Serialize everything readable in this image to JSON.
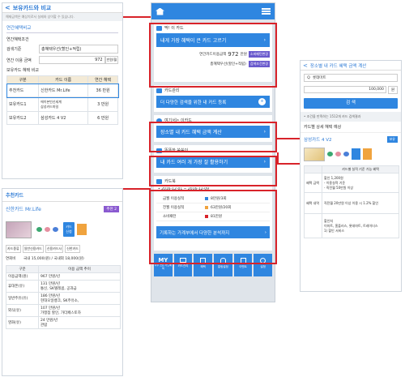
{
  "left_panel": {
    "back": "<",
    "title": "보유카드와 비교",
    "note": "해제금액은 예상치로서 실제와 상이할 수 있습니다.",
    "section1": "연간혜택비교",
    "cond_title": "연간혜택조건",
    "cond_rows": [
      {
        "label": "검색기준",
        "value": "총혜택우선(할인+적립)"
      },
      {
        "label": "연간 이용 금액",
        "value": "972",
        "unit": "만원/월"
      }
    ],
    "section2": "보유카드 혜택 비교",
    "table_headers": [
      "구분",
      "카드 이름",
      "연간 혜택"
    ],
    "table_rows": [
      {
        "type": "추천카드",
        "name": "신한카드 Mr.Life",
        "benefit": "36 만원"
      },
      {
        "type": "보유카드1",
        "name": "에이본빈신세계\n삼성카드마일",
        "benefit": "3 만원"
      },
      {
        "type": "보유카드2",
        "name": "삼성카드 4 V2",
        "benefit": "6 만원"
      }
    ]
  },
  "rec_panel": {
    "title": "추천카드",
    "card_name": "신한카드 Mr.Life",
    "badge": "추천 2",
    "icons": [
      "보유카드 비교",
      "관심카드 담기",
      "카드사 홈페이지"
    ],
    "apply": "카드신청",
    "tags": [
      "카드종류",
      "일반신용카드",
      "신용카드사",
      "신한카드"
    ],
    "fee_label": "연회비",
    "fee_value": "국내 15,000(원) / 국내외 18,000(원)",
    "th": [
      "구분",
      "이용 금액 추이"
    ],
    "rows": [
      {
        "a": "이용금액(원)",
        "b": "967 만원/년"
      },
      {
        "a": "휴대폰(유)",
        "b": "131 만원/년\n통신, SK텔레콤, 공과금"
      },
      {
        "a": "일반주유(유)",
        "b": "186 만원/년\n현대오일뱅크, SK주유소,"
      },
      {
        "a": "외식(유)",
        "b": "107 만원/년\n가맹점 할인, 가더페스토하"
      },
      {
        "a": "영화(유)",
        "b": "24 만원/년\n관람"
      }
    ]
  },
  "phone": {
    "status": "",
    "s1_label": "딱! 이 카드",
    "s1_btn": "내게 가장 혜택이 큰 카드 고르기",
    "s1_l1": "연간카드이용금액",
    "s1_v1": "972",
    "s1_u1": "만원",
    "s1_b1": "소비패턴변경",
    "s1_l2": "총혜택우선(할인+적립)",
    "s1_b2": "검색조건변경",
    "s2_label": "카드관리",
    "s2_btn": "더 다양한 검색을 위한 내 카드 등록",
    "s3_label": "여기서는 이카드",
    "s3_btn": "장소별 내 카드 혜택 금액 계산",
    "s4_label": "똑똑한 씀씀이",
    "s4_btn": "내 카드 여러 개 가장 잘 활용하기",
    "s5_label": "카드북",
    "s5_date": "• 2016-12-01 ~ 2016-12-09",
    "s5_rows": [
      {
        "k": "금월 이용실적",
        "v": "8만원/3회"
      },
      {
        "k": "전월 이용실적",
        "v": "63만원/20회"
      },
      {
        "k": "소비패턴",
        "v": "81만원"
      }
    ],
    "s5_btn": "기록하는 가계부에서 다양한 분석까지",
    "tabs": [
      "MY",
      "카드관리",
      "혜택",
      "알림설정",
      "이벤트",
      "설정"
    ],
    "tab_sub": "자주 쓰는 카드혜택"
  },
  "right_panel": {
    "back": "<",
    "title": "장소별 내 카드 혜택 금액 계산",
    "q_label": "Q",
    "q_value": "롯데마트",
    "amt": "100,000",
    "amt_unit": "원",
    "search": "검 색",
    "note": "• 조건을 만족하는 1512개 카드 검색결과",
    "sub": "카드별 상세 혜택 예상",
    "card": "삼성카드 4 V2",
    "card_btn": "보유",
    "col1": "카드별 실적 기준 가능 혜택",
    "benefit_label": "혜택 금액",
    "benefit_val": "할인 1,200원",
    "b_lines": [
      "- 이용실적 기준",
      "- 직전월 50만원 이상"
    ],
    "detail_label": "혜택 내역",
    "detail": "직전월 20만원 이상 이용 시 1.2% 할인",
    "extra_label": "할인처",
    "extra": "이마트, 홈플러스, 롯데마트, 트레이더스",
    "extra2": "1) 할인 서비스"
  },
  "colors": {
    "accent": "#2f86e0",
    "red": "#d8232a",
    "purple": "#6a5acd"
  }
}
